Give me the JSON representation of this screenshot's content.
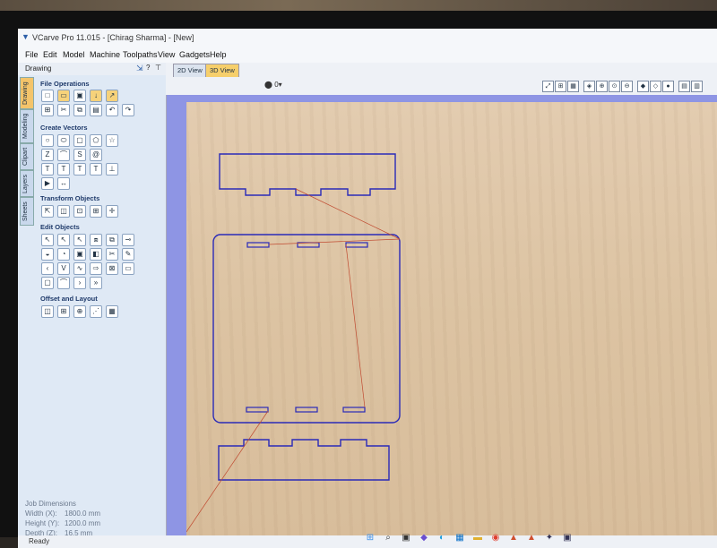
{
  "window": {
    "title": "VCarve Pro 11.015 - [Chirag Sharma] - [New]"
  },
  "menu": [
    "File",
    "Edit",
    "Model",
    "Machine",
    "Toolpaths",
    "View",
    "Gadgets",
    "Help"
  ],
  "panel": {
    "title": "Drawing"
  },
  "side_tabs": [
    "Drawing",
    "Modeling",
    "Clipart",
    "Layers",
    "Sheets"
  ],
  "sections": {
    "file_ops": "File Operations",
    "create_vectors": "Create Vectors",
    "transform": "Transform Objects",
    "edit": "Edit Objects",
    "offset": "Offset and Layout"
  },
  "view_tabs": {
    "v2d": "2D View",
    "v3d": "3D View",
    "zero": "0"
  },
  "job": {
    "title": "Job Dimensions",
    "width_label": "Width  (X):",
    "width": "1800.0 mm",
    "height_label": "Height (Y):",
    "height": "1200.0 mm",
    "depth_label": "Depth  (Z):",
    "depth": "16.5 mm"
  },
  "status": "Ready",
  "colors": {
    "vector": "#2a2ab8",
    "toolpath_line": "#c04a30",
    "canvas_bg": "#8e95e4",
    "active_tab": "#f6cf6b"
  },
  "icons": {
    "file_ops": [
      "new-file-icon",
      "open-file-icon",
      "save-file-icon",
      "import-icon",
      "export-icon",
      "settings-icon",
      "cut-icon",
      "copy-icon",
      "paste-icon",
      "undo-icon",
      "redo-icon"
    ],
    "taskbar": [
      "start-icon",
      "search-icon",
      "task-view-icon",
      "copilot-icon",
      "edge-icon",
      "store-icon",
      "explorer-icon",
      "chrome-icon",
      "vectric-icon",
      "vectric2-icon",
      "app-icon",
      "app2-icon"
    ]
  }
}
